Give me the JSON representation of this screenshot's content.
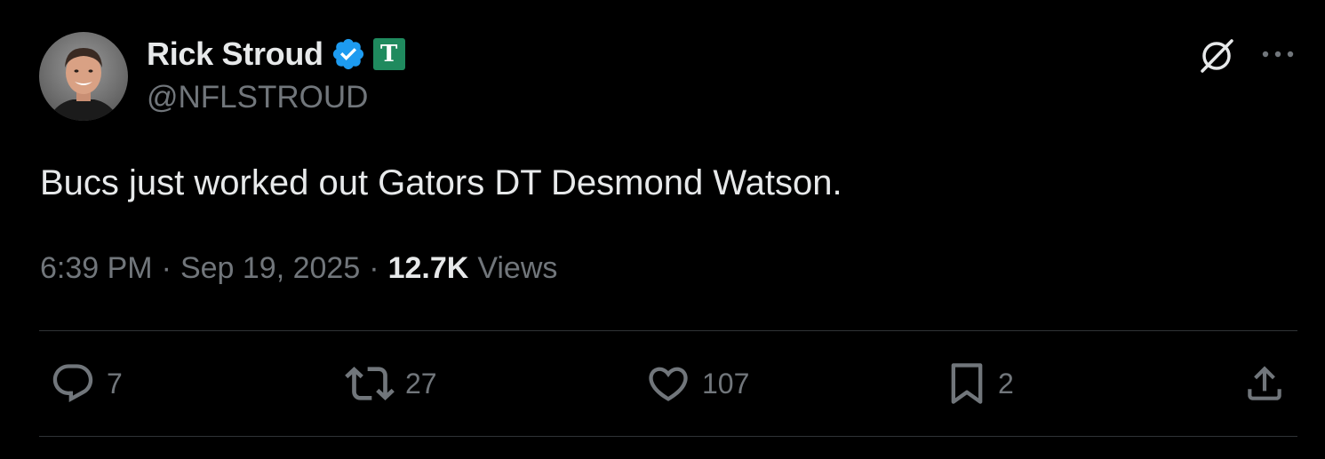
{
  "author": {
    "display_name": "Rick Stroud",
    "handle": "@NFLSTROUD",
    "verified": true,
    "affiliate_badge_letter": "T",
    "affiliate_badge_color": "#1f8a5e",
    "verified_color": "#1d9bf0"
  },
  "tweet": {
    "text": "Bucs just worked out Gators DT Desmond Watson.",
    "time": "6:39 PM",
    "separator": "·",
    "date": "Sep 19, 2025",
    "views_count": "12.7K",
    "views_label": "Views"
  },
  "actions": {
    "reply": {
      "icon": "reply-icon",
      "count": "7"
    },
    "repost": {
      "icon": "repost-icon",
      "count": "27"
    },
    "like": {
      "icon": "heart-icon",
      "count": "107"
    },
    "bookmark": {
      "icon": "bookmark-icon",
      "count": "2"
    },
    "share": {
      "icon": "share-icon"
    }
  },
  "header_icons": [
    "grok-icon",
    "more-icon"
  ],
  "colors": {
    "background": "#000000",
    "text_primary": "#e7e9ea",
    "text_secondary": "#71767b",
    "divider": "#2f3336"
  }
}
